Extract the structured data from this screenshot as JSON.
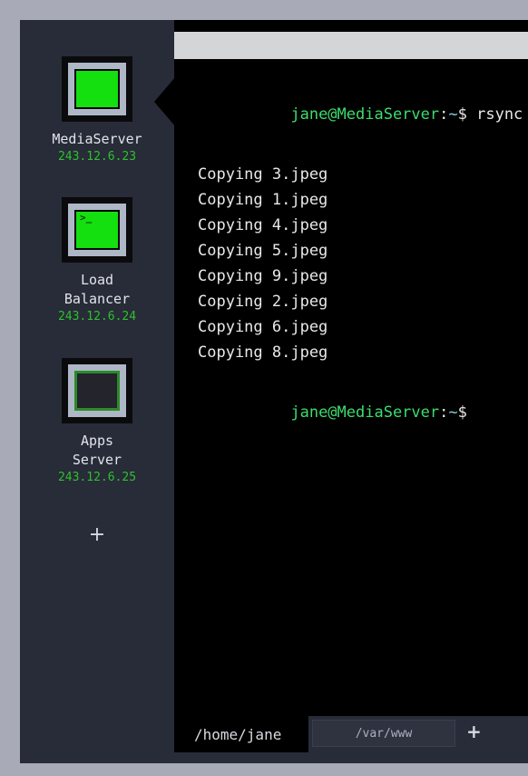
{
  "window": {
    "accent_green": "#14e010",
    "ip_green": "#2cc22c",
    "sidebar_bg": "#282b38",
    "terminal_bg": "#000000",
    "desktop_bg": "#a8aab8"
  },
  "sidebar": {
    "servers": [
      {
        "name": "MediaServer",
        "ip": "243.12.6.23",
        "state": "on",
        "glyph": "",
        "selected": true
      },
      {
        "name": "Load\nBalancer",
        "ip": "243.12.6.24",
        "state": "on",
        "glyph": ">_",
        "selected": false
      },
      {
        "name": "Apps\nServer",
        "ip": "243.12.6.25",
        "state": "off",
        "glyph": "",
        "selected": false
      }
    ],
    "add_server_label": "+"
  },
  "terminal": {
    "prompt": {
      "user_host": "jane@MediaServer",
      "colon": ":",
      "path": "~",
      "sigil": "$"
    },
    "command": " rsync -av",
    "output_lines": [
      "Copying 3.jpeg",
      "Copying 1.jpeg",
      "Copying 4.jpeg",
      "Copying 5.jpeg",
      "Copying 9.jpeg",
      "Copying 2.jpeg",
      "Copying 6.jpeg",
      "Copying 8.jpeg"
    ],
    "tabs": [
      {
        "label": "/home/jane",
        "active": true
      },
      {
        "label": "/var/www",
        "active": false
      }
    ],
    "new_tab_label": "+"
  }
}
